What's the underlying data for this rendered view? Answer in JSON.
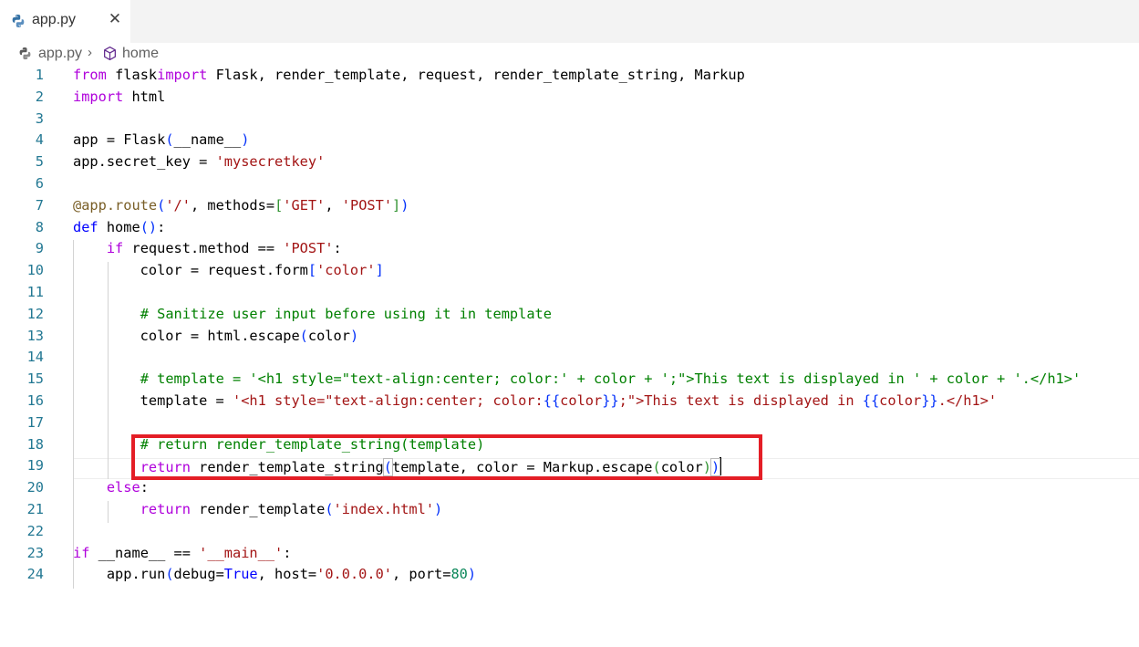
{
  "tab": {
    "label": "app.py",
    "close_glyph": "✕"
  },
  "breadcrumb": {
    "file": "app.py",
    "separator": "›",
    "symbol": "home"
  },
  "editor": {
    "line_numbers": [
      "1",
      "2",
      "3",
      "4",
      "5",
      "6",
      "7",
      "8",
      "9",
      "10",
      "11",
      "12",
      "13",
      "14",
      "15",
      "16",
      "17",
      "18",
      "19",
      "20",
      "21",
      "22",
      "23",
      "24"
    ],
    "lines": [
      [
        [
          "kc",
          "from"
        ],
        [
          "",
          "flask"
        ],
        [
          "kc",
          "import"
        ],
        [
          "",
          "Flask, render_template, request, render_template_string, Markup"
        ]
      ],
      [
        [
          "kc",
          "import"
        ],
        [
          "",
          "html"
        ]
      ],
      [],
      [
        [
          "",
          "app = Flask"
        ],
        [
          "bk",
          "("
        ],
        [
          "",
          "__name__"
        ],
        [
          "bk",
          ")"
        ]
      ],
      [
        [
          "",
          "app.secret_key = "
        ],
        [
          "str",
          "'mysecretkey'"
        ]
      ],
      [],
      [
        [
          "dec",
          "@app.route"
        ],
        [
          "bk",
          "("
        ],
        [
          "str",
          "'/'"
        ],
        [
          "",
          ", methods="
        ],
        [
          "bk2",
          "["
        ],
        [
          "str",
          "'GET'"
        ],
        [
          "",
          ", "
        ],
        [
          "str",
          "'POST'"
        ],
        [
          "bk2",
          "]"
        ],
        [
          "bk",
          ")"
        ]
      ],
      [
        [
          "kw",
          "def"
        ],
        [
          "",
          "home"
        ],
        [
          "bk",
          "()"
        ],
        [
          "",
          ":"
        ]
      ],
      [
        [
          "",
          "    "
        ],
        [
          "kc",
          "if"
        ],
        [
          "",
          "request.method == "
        ],
        [
          "str",
          "'POST'"
        ],
        [
          "",
          ":"
        ]
      ],
      [
        [
          "",
          "        color = request.form"
        ],
        [
          "bk",
          "["
        ],
        [
          "str",
          "'color'"
        ],
        [
          "bk",
          "]"
        ]
      ],
      [],
      [
        [
          "",
          "        "
        ],
        [
          "cmt",
          "# Sanitize user input before using it in template"
        ]
      ],
      [
        [
          "",
          "        color = html.escape"
        ],
        [
          "bk",
          "("
        ],
        [
          "",
          "color"
        ],
        [
          "bk",
          ")"
        ]
      ],
      [],
      [
        [
          "",
          "        "
        ],
        [
          "cmt",
          "# template = '<h1 style=\"text-align:center; color:' + color + ';\">This text is displayed in ' + color + '.</h1>'"
        ]
      ],
      [
        [
          "",
          "        template = "
        ],
        [
          "str",
          "'<h1 style=\"text-align:center; color:"
        ],
        [
          "bk",
          "{{"
        ],
        [
          "str",
          "color"
        ],
        [
          "bk",
          "}}"
        ],
        [
          "str",
          ";\">This text is displayed in "
        ],
        [
          "bk",
          "{{"
        ],
        [
          "str",
          "color"
        ],
        [
          "bk",
          "}}"
        ],
        [
          "str",
          ".</h1>'"
        ]
      ],
      [],
      [
        [
          "",
          "        "
        ],
        [
          "cmt",
          "# return render_template_string(template)"
        ]
      ],
      [
        [
          "",
          "        "
        ],
        [
          "kc",
          "return"
        ],
        [
          "",
          "render_template_string"
        ],
        [
          "bkm",
          "("
        ],
        [
          "",
          "template, color = Markup.escape"
        ],
        [
          "bk2",
          "("
        ],
        [
          "",
          "color"
        ],
        [
          "bk2",
          ")"
        ],
        [
          "bkm",
          ")"
        ],
        [
          "caret",
          ""
        ]
      ],
      [
        [
          "",
          "    "
        ],
        [
          "kc",
          "else"
        ],
        [
          "",
          ":"
        ]
      ],
      [
        [
          "",
          "        "
        ],
        [
          "kc",
          "return"
        ],
        [
          "",
          "render_template"
        ],
        [
          "bk",
          "("
        ],
        [
          "str",
          "'index.html'"
        ],
        [
          "bk",
          ")"
        ]
      ],
      [],
      [
        [
          "kc",
          "if"
        ],
        [
          "",
          "__name__ == "
        ],
        [
          "str",
          "'__main__'"
        ],
        [
          "",
          ":"
        ]
      ],
      [
        [
          "",
          "    app.run"
        ],
        [
          "bk",
          "("
        ],
        [
          "",
          "debug="
        ],
        [
          "kw",
          "True"
        ],
        [
          "",
          ", host="
        ],
        [
          "str",
          "'0.0.0.0'"
        ],
        [
          "",
          ", port="
        ],
        [
          "num",
          "80"
        ],
        [
          "bk",
          ")"
        ]
      ]
    ]
  }
}
